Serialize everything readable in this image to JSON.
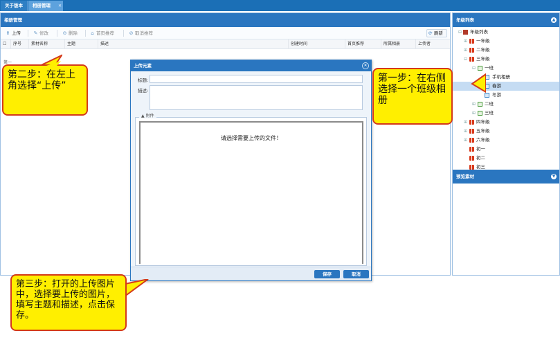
{
  "tabs": [
    {
      "label": "关于版本"
    },
    {
      "label": "相册管理"
    }
  ],
  "main": {
    "title": "相册管理",
    "toolbar": {
      "upload": "上传",
      "edit": "修改",
      "delete": "删除",
      "recommend": "首页推荐",
      "cancel_recommend": "取消推荐",
      "refresh": "刷新"
    },
    "columns": [
      "序号",
      "素材名称",
      "主题",
      "描述",
      "创建时间",
      "首页推荐",
      "所属相册",
      "上传者"
    ],
    "footer_text": "第一"
  },
  "right": {
    "title": "年级列表",
    "tree": [
      {
        "label": "年级列表",
        "level": 0
      },
      {
        "label": "一年级",
        "level": 1
      },
      {
        "label": "二年级",
        "level": 1
      },
      {
        "label": "三年级",
        "level": 1
      },
      {
        "label": "一班",
        "level": 2
      },
      {
        "label": "手机相册",
        "level": 3
      },
      {
        "label": "春游",
        "level": 3,
        "selected": true
      },
      {
        "label": "冬游",
        "level": 3
      },
      {
        "label": "二班",
        "level": 2
      },
      {
        "label": "三班",
        "level": 2
      },
      {
        "label": "四年级",
        "level": 1
      },
      {
        "label": "五年级",
        "level": 1
      },
      {
        "label": "六年级",
        "level": 1
      },
      {
        "label": "初一",
        "level": 1
      },
      {
        "label": "初二",
        "level": 1
      },
      {
        "label": "初三",
        "level": 1
      }
    ],
    "preview_title": "预览素材"
  },
  "dialog": {
    "title": "上传元素",
    "title_label": "标题:",
    "desc_label": "描述:",
    "attach_legend": "附件",
    "attach_message": "请选择需要上传的文件！",
    "save": "保存",
    "cancel": "取消"
  },
  "callouts": {
    "step1": "第一步：在右侧选择一个班级相册",
    "step2": "第二步：在左上角选择“上传”",
    "step3": "第三步：打开的上传图片中，选择要上传的图片，填写主题和描述，点击保存。"
  },
  "colors": {
    "header_blue": "#2a76c0",
    "callout_yellow": "#ffef00",
    "callout_border": "#d43a1a",
    "selected_row": "#c5dcf3"
  }
}
